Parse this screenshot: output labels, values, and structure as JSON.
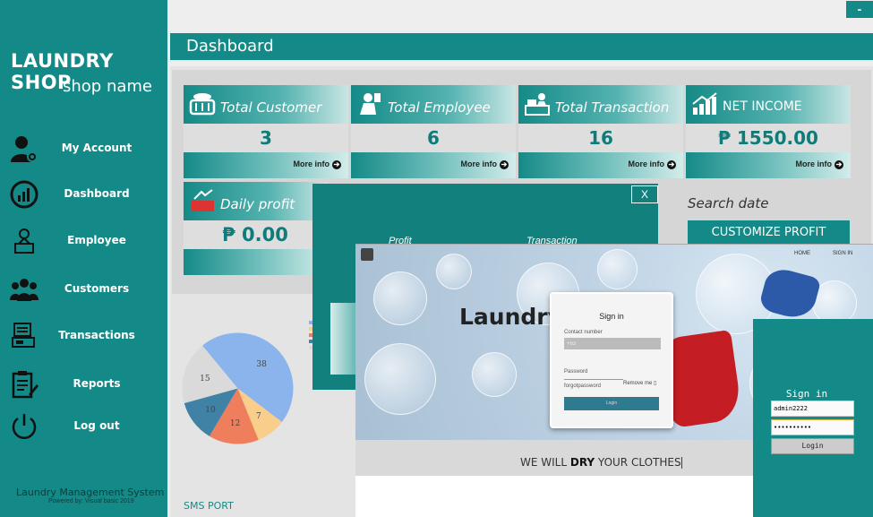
{
  "app": {
    "brand": "LAUNDRY SHOP",
    "shop_name": "shop name",
    "minimize_label": "-",
    "footer_title": "Laundry Management System",
    "footer_sub": "Powered by: Visual basic 2019"
  },
  "sidebar": {
    "items": [
      {
        "label": "My Account",
        "icon": "user-gear-icon"
      },
      {
        "label": "Dashboard",
        "icon": "gauge-icon"
      },
      {
        "label": "Employee",
        "icon": "employee-icon"
      },
      {
        "label": "Customers",
        "icon": "group-icon"
      },
      {
        "label": "Transactions",
        "icon": "register-icon"
      },
      {
        "label": "Reports",
        "icon": "clipboard-icon"
      },
      {
        "label": "Log out",
        "icon": "power-icon"
      }
    ]
  },
  "header": {
    "title": "Dashboard"
  },
  "cards": [
    {
      "title": "Total Customer",
      "value": "3",
      "more": "More info",
      "icon": "basket-icon"
    },
    {
      "title": "Total Employee",
      "value": "6",
      "more": "More info",
      "icon": "worker-icon"
    },
    {
      "title": "Total Transaction",
      "value": "16",
      "more": "More info",
      "icon": "cashier-icon"
    },
    {
      "title": "NET INCOME",
      "value": "₱ 1550.00",
      "more": "More info",
      "icon": "growth-icon"
    },
    {
      "title": "Daily profit",
      "value": "₱ 0.00",
      "icon": "profit-icon"
    }
  ],
  "right_panel": {
    "search_date": "Search date",
    "customize_button": "CUSTOMIZE PROFIT"
  },
  "sms_port": "SMS PORT",
  "dialog": {
    "close_label": "X",
    "label_profit": "Profit",
    "label_transaction": "Transaction"
  },
  "web": {
    "nav_home": "HOME",
    "nav_signin": "SIGN IN",
    "hero_text": "Laundry                  es here",
    "tagline_pre": "WE WILL ",
    "tagline_bold": "DRY",
    "tagline_post": " YOUR CLOTHES",
    "signin": {
      "title": "Sign in",
      "contact_label": "Contact number",
      "contact_value": "+63",
      "password_label": "Password",
      "forgot": "forgotpassword",
      "remember": "Remove me ▯",
      "login": "Login"
    }
  },
  "mini_login": {
    "title": "Sign in",
    "username": "admin2222",
    "password": "••••••••••",
    "button": "Login"
  },
  "chart_data": {
    "type": "pie",
    "categories": [
      "38",
      "7",
      "12",
      "10",
      "15"
    ],
    "values": [
      38,
      7,
      12,
      10,
      15
    ],
    "colors": [
      "#8bb4ec",
      "#f8ce8a",
      "#ee7e5c",
      "#3f82a6",
      "#dadada"
    ],
    "title": ""
  }
}
